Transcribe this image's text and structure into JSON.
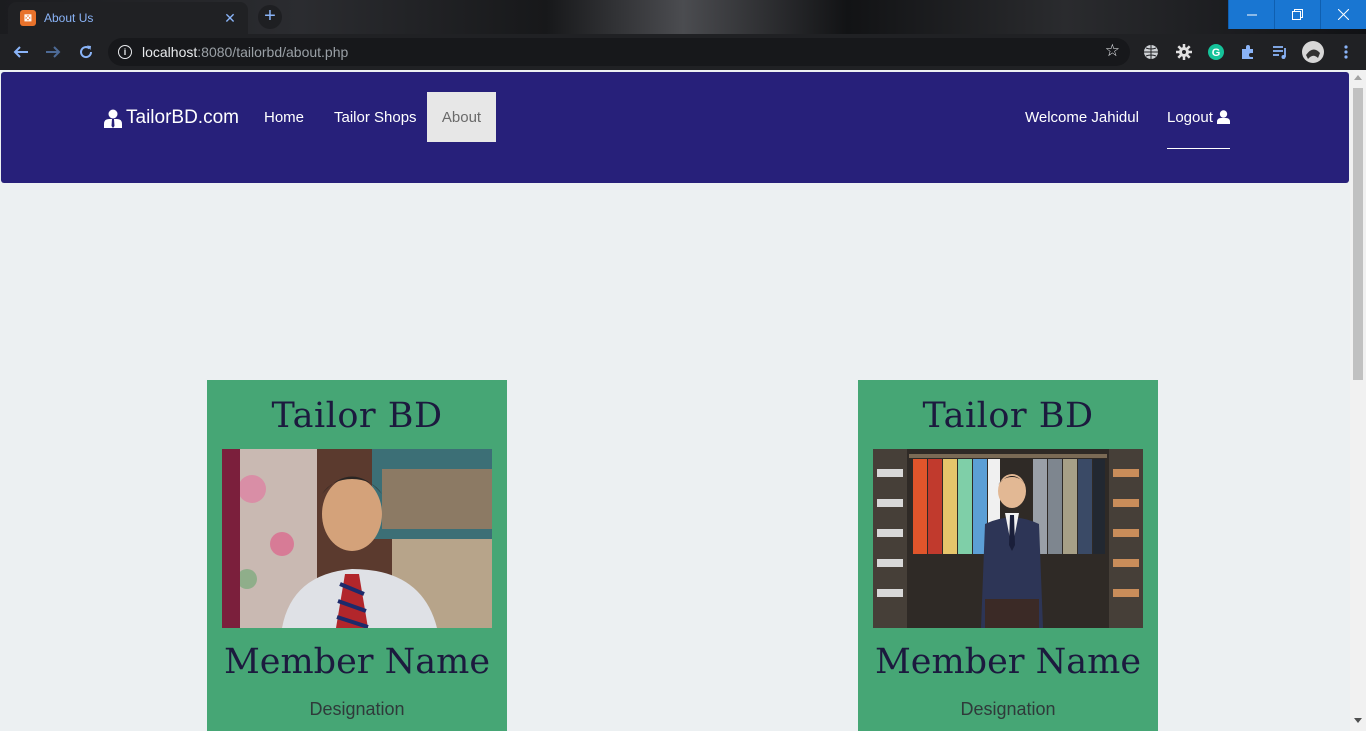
{
  "browser": {
    "tab_title": "About Us",
    "tab_favicon": "xampp-icon",
    "url_host": "localhost",
    "url_rest": ":8080/tailorbd/about.php"
  },
  "navbar": {
    "brand": "TailorBD.com",
    "links": [
      "Home",
      "Tailor Shops",
      "About"
    ],
    "active": "About",
    "welcome": "Welcome Jahidul",
    "logout": "Logout"
  },
  "cards": [
    {
      "title": "Tailor BD",
      "photo": "tailor-portrait-photo",
      "member_name": "Member Name",
      "designation": "Designation"
    },
    {
      "title": "Tailor BD",
      "photo": "suit-wardrobe-photo",
      "member_name": "Member Name",
      "designation": "Designation"
    }
  ],
  "colors": {
    "navbar": "#27207a",
    "card": "#46a675",
    "page_bg": "#ecf0f2",
    "active_link_bg": "#e7e7e7"
  }
}
